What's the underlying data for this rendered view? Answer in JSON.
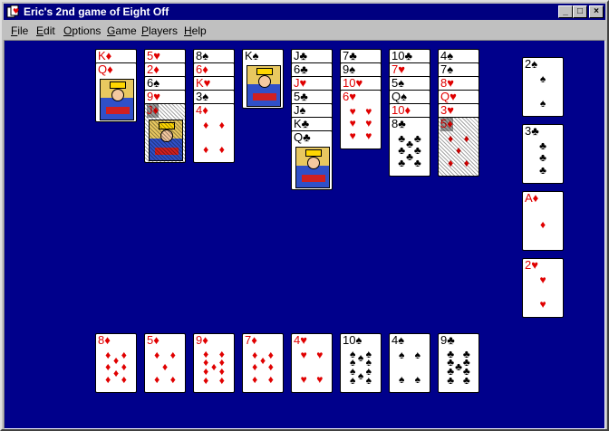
{
  "window": {
    "title": "Eric's 2nd game of Eight Off",
    "min_label": "_",
    "max_label": "□",
    "close_label": "×"
  },
  "menu": [
    {
      "label": "File",
      "key": "F",
      "rest": "ile"
    },
    {
      "label": "Edit",
      "key": "E",
      "rest": "dit"
    },
    {
      "label": "Options",
      "key": "O",
      "rest": "ptions"
    },
    {
      "label": "Game",
      "key": "G",
      "rest": "ame"
    },
    {
      "label": "Players",
      "key": "P",
      "rest": "layers"
    },
    {
      "label": "Help",
      "key": "H",
      "rest": "elp"
    }
  ],
  "colors": {
    "table": "#00008b",
    "red_suit": "#e00000",
    "titlebar": "#000080"
  },
  "tableau": [
    {
      "column": 1,
      "cards": [
        {
          "rank": "K",
          "suit": "♦"
        },
        {
          "rank": "Q",
          "suit": "♦"
        }
      ]
    },
    {
      "column": 2,
      "cards": [
        {
          "rank": "5",
          "suit": "♥"
        },
        {
          "rank": "2",
          "suit": "♦"
        },
        {
          "rank": "6",
          "suit": "♠"
        },
        {
          "rank": "9",
          "suit": "♥"
        },
        {
          "rank": "J",
          "suit": "♦",
          "selected": true
        }
      ]
    },
    {
      "column": 3,
      "cards": [
        {
          "rank": "8",
          "suit": "♠"
        },
        {
          "rank": "6",
          "suit": "♦"
        },
        {
          "rank": "K",
          "suit": "♥"
        },
        {
          "rank": "3",
          "suit": "♠"
        },
        {
          "rank": "4",
          "suit": "♦"
        }
      ]
    },
    {
      "column": 4,
      "cards": [
        {
          "rank": "K",
          "suit": "♠"
        }
      ]
    },
    {
      "column": 5,
      "cards": [
        {
          "rank": "J",
          "suit": "♣"
        },
        {
          "rank": "6",
          "suit": "♣"
        },
        {
          "rank": "J",
          "suit": "♥"
        },
        {
          "rank": "5",
          "suit": "♣"
        },
        {
          "rank": "J",
          "suit": "♠"
        },
        {
          "rank": "K",
          "suit": "♣"
        },
        {
          "rank": "Q",
          "suit": "♣"
        }
      ]
    },
    {
      "column": 6,
      "cards": [
        {
          "rank": "7",
          "suit": "♣"
        },
        {
          "rank": "9",
          "suit": "♠"
        },
        {
          "rank": "10",
          "suit": "♥"
        },
        {
          "rank": "6",
          "suit": "♥"
        }
      ]
    },
    {
      "column": 7,
      "cards": [
        {
          "rank": "10",
          "suit": "♣"
        },
        {
          "rank": "7",
          "suit": "♥"
        },
        {
          "rank": "5",
          "suit": "♠"
        },
        {
          "rank": "Q",
          "suit": "♠"
        },
        {
          "rank": "10",
          "suit": "♦"
        },
        {
          "rank": "8",
          "suit": "♣"
        }
      ]
    },
    {
      "column": 8,
      "cards": [
        {
          "rank": "4",
          "suit": "♠"
        },
        {
          "rank": "7",
          "suit": "♠"
        },
        {
          "rank": "8",
          "suit": "♥"
        },
        {
          "rank": "Q",
          "suit": "♥"
        },
        {
          "rank": "3",
          "suit": "♥"
        },
        {
          "rank": "5",
          "suit": "♦",
          "selected": true
        }
      ]
    }
  ],
  "foundations": [
    {
      "rank": "2",
      "suit": "♠"
    },
    {
      "rank": "3",
      "suit": "♣"
    },
    {
      "rank": "A",
      "suit": "♦"
    },
    {
      "rank": "2",
      "suit": "♥"
    }
  ],
  "reserve": [
    {
      "rank": "8",
      "suit": "♦"
    },
    {
      "rank": "5",
      "suit": "♦"
    },
    {
      "rank": "9",
      "suit": "♦"
    },
    {
      "rank": "7",
      "suit": "♦"
    },
    {
      "rank": "4",
      "suit": "♥"
    },
    {
      "rank": "10",
      "suit": "♠"
    },
    {
      "rank": "4",
      "suit": "♠"
    },
    {
      "rank": "9",
      "suit": "♣"
    }
  ]
}
